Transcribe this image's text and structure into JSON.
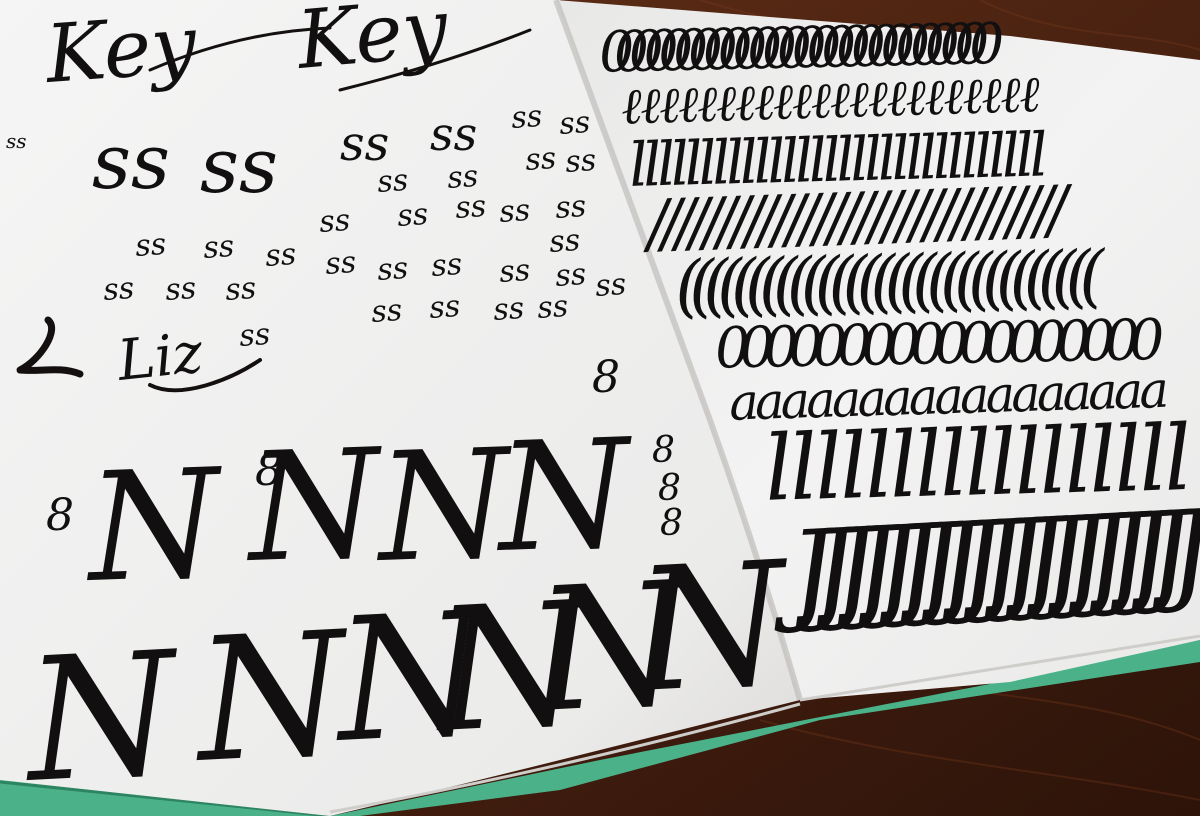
{
  "photo": {
    "subject": "calligraphy practice sketchbook",
    "colors": {
      "table": "#5a2c17",
      "paper": "#fbfbfa",
      "ink": "#141110",
      "cover_edge": "#5ac49a"
    }
  },
  "left_page": {
    "headline_words": [
      "Key",
      "Key"
    ],
    "name_word": "Liz",
    "small_glyph": "ss",
    "eight_glyph": "8",
    "big_letter": "N"
  },
  "right_page": {
    "rows": [
      {
        "glyph": "0",
        "count": 26
      },
      {
        "glyph": "ℓ",
        "count": 22
      },
      {
        "glyph": "l",
        "count": 30
      },
      {
        "glyph": "/",
        "count": 30
      },
      {
        "glyph": "(",
        "count": 30
      },
      {
        "glyph": "0",
        "count": 18
      },
      {
        "glyph": "a",
        "count": 17
      },
      {
        "glyph": "l",
        "count": 17
      },
      {
        "glyph": "J",
        "count": 19
      }
    ]
  }
}
